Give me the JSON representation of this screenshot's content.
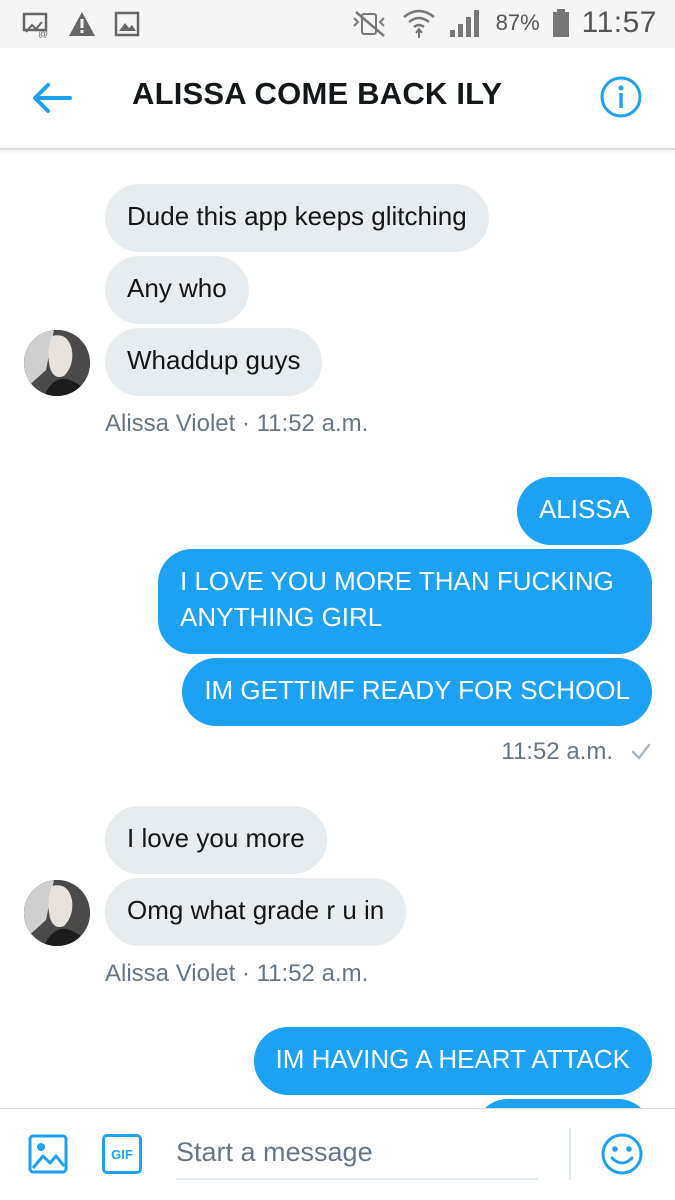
{
  "status_bar": {
    "battery_percent": "87%",
    "time": "11:57",
    "icons": [
      "screen-share-icon",
      "warning-icon",
      "image-icon",
      "mute-vibrate-icon",
      "wifi-icon",
      "signal-icon",
      "battery-icon"
    ]
  },
  "header": {
    "title": "ALISSA COME BACK ILY",
    "back_icon": "arrow-left-icon",
    "info_icon": "info-icon"
  },
  "messages": {
    "group1": {
      "items": [
        "Dude this app keeps glitching",
        "Any who",
        "Whaddup guys"
      ],
      "meta": "Alissa Violet · 11:52 a.m."
    },
    "group2": {
      "items": [
        "ALISSA",
        "I LOVE YOU MORE THAN FUCKING ANYTHING GIRL",
        "IM GETTIMF READY FOR SCHOOL"
      ],
      "meta": "11:52 a.m.",
      "read_icon": "checkmark-icon"
    },
    "group3": {
      "items": [
        "I love you more",
        "Omg what grade r u in"
      ],
      "meta": "Alissa Violet · 11:52 a.m."
    },
    "group4": {
      "items": [
        "IM HAVING A HEART ATTACK"
      ]
    }
  },
  "composer": {
    "placeholder": "Start a message",
    "value": "",
    "image_icon": "image-icon",
    "gif_label": "GIF",
    "emoji_icon": "smiley-icon"
  },
  "colors": {
    "accent": "#1da1f2",
    "incoming_bubble": "#e6ecf0",
    "meta_text": "#657786"
  }
}
